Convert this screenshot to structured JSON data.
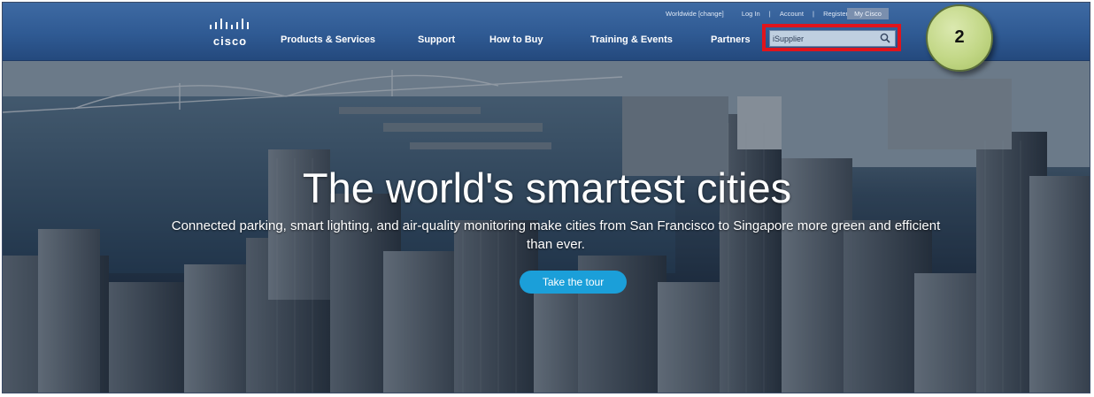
{
  "header": {
    "utility_links": {
      "worldwide": "Worldwide [change]",
      "login": "Log In",
      "separator": "|",
      "account": "Account",
      "register": "Register",
      "my_cisco": "My Cisco"
    },
    "logo_text": "cisco",
    "nav": [
      {
        "label": "Products & Services"
      },
      {
        "label": "Support"
      },
      {
        "label": "How to Buy"
      },
      {
        "label": "Training & Events"
      },
      {
        "label": "Partners"
      }
    ],
    "search": {
      "value": "iSupplier",
      "icon": "search-icon",
      "highlight_color": "#e0141c"
    },
    "background_color": "#2f5a93"
  },
  "callout": {
    "number": "2",
    "color": "#c2d786"
  },
  "hero": {
    "headline": "The world's smartest cities",
    "subheadline": "Connected parking, smart lighting, and air-quality monitoring make cities from San Francisco to Singapore more green and efficient than ever.",
    "cta_label": "Take the tour",
    "cta_color": "#1b9fd9"
  }
}
